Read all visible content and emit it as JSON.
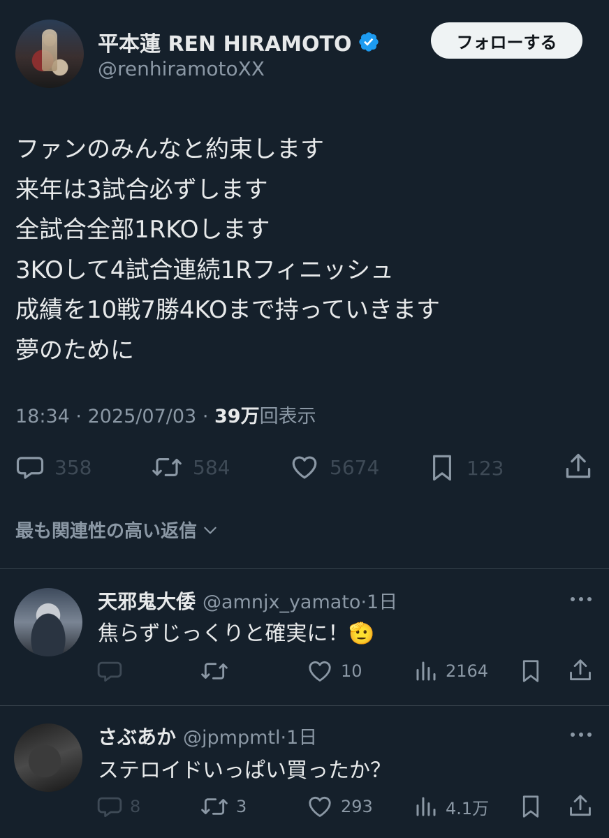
{
  "tweet": {
    "author": {
      "name": "平本蓮 REN HIRAMOTO",
      "handle": "@renhiramotoXX",
      "verified": true
    },
    "follow_label": "フォローする",
    "text_lines": [
      "ファンのみんなと約束します",
      "来年は3試合必ずします",
      "全試合全部1RKOします",
      "3KOして4試合連続1Rフィニッシュ",
      "成績を10戦7勝4KOまで持っていきます",
      "夢のために"
    ],
    "time": "18:34",
    "separator": "·",
    "date": "2025/07/03",
    "views_count": "39万",
    "views_label": "回表示",
    "stats": {
      "replies": "358",
      "retweets": "584",
      "likes": "5674",
      "bookmarks": "123"
    }
  },
  "replies_sort_label": "最も関連性の高い返信",
  "replies": [
    {
      "name": "天邪鬼大倭",
      "handle": "@amnjx_yamato",
      "age": "·1日",
      "text": "焦らずじっくりと確実に！🫡",
      "replies": "",
      "retweets": "",
      "likes": "10",
      "views": "2164"
    },
    {
      "name": "さぶあか",
      "handle": "@jpmpmtl",
      "age": "·1日",
      "text": "ステロイドいっぱい買ったか？",
      "replies": "8",
      "retweets": "3",
      "likes": "293",
      "views": "4.1万"
    }
  ],
  "colors": {
    "background": "#15202b",
    "text": "#e7e9ea",
    "secondary": "#8b98a5",
    "verified": "#1d9bf0",
    "divider": "#38444d"
  },
  "icons": [
    "verified-badge-icon",
    "reply-icon",
    "retweet-icon",
    "like-icon",
    "bookmark-icon",
    "share-icon",
    "views-icon",
    "more-icon",
    "chevron-down-icon"
  ]
}
